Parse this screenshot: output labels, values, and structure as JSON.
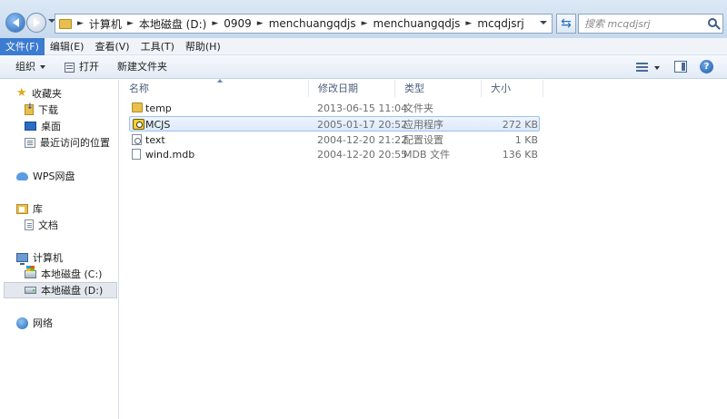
{
  "address_bar": {
    "breadcrumbs": [
      "计算机",
      "本地磁盘 (D:)",
      "0909",
      "menchuangqdjs",
      "menchuangqdjs",
      "mcqdjsrj"
    ],
    "separator": "►",
    "search_placeholder": "搜索 mcqdjsrj"
  },
  "menu": {
    "items": [
      "文件(F)",
      "编辑(E)",
      "查看(V)",
      "工具(T)",
      "帮助(H)"
    ],
    "active_index": 0
  },
  "toolbar": {
    "organize_label": "组织",
    "open_label": "打开",
    "new_folder_label": "新建文件夹",
    "help_label": "?"
  },
  "nav": {
    "favorites": {
      "label": "收藏夹",
      "items": [
        "下载",
        "桌面",
        "最近访问的位置"
      ]
    },
    "wps": {
      "label": "WPS网盘"
    },
    "library": {
      "label": "库",
      "items": [
        "文档"
      ]
    },
    "computer": {
      "label": "计算机",
      "items": [
        "本地磁盘 (C:)",
        "本地磁盘 (D:)"
      ],
      "selected": "本地磁盘 (D:)"
    },
    "network": {
      "label": "网络"
    }
  },
  "columns": {
    "name": "名称",
    "modified": "修改日期",
    "type": "类型",
    "size": "大小"
  },
  "files": [
    {
      "name": "temp",
      "modified": "2013-06-15 11:04",
      "type": "文件夹",
      "size": "",
      "icon": "folder-icon",
      "selected": false
    },
    {
      "name": "MCJS",
      "modified": "2005-01-17 20:52",
      "type": "应用程序",
      "size": "272 KB",
      "icon": "application-icon",
      "selected": true
    },
    {
      "name": "text",
      "modified": "2004-12-20 21:22",
      "type": "配置设置",
      "size": "1 KB",
      "icon": "config-file-icon",
      "selected": false
    },
    {
      "name": "wind.mdb",
      "modified": "2004-12-20 20:55",
      "type": "MDB 文件",
      "size": "136 KB",
      "icon": "file-icon",
      "selected": false
    }
  ],
  "colors": {
    "menu_active": "#3b7bd0",
    "selection_border": "#9dc1ec",
    "chrome_background": "#dce9f6"
  }
}
